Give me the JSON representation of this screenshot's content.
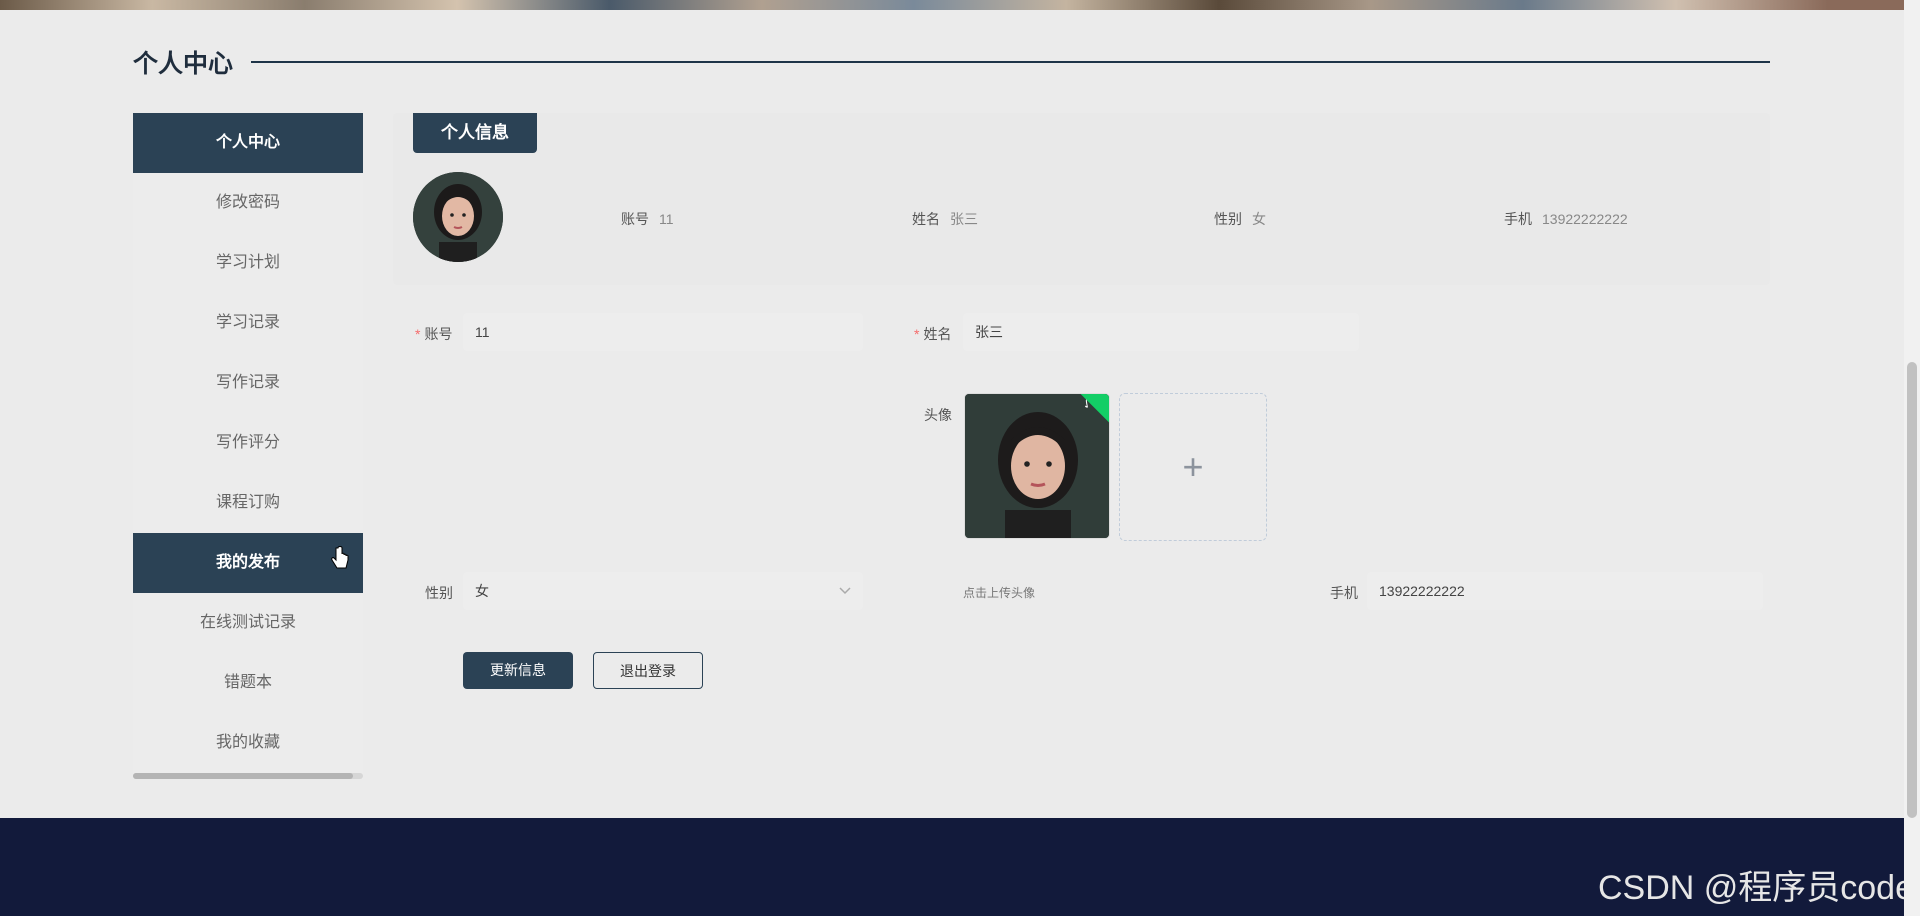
{
  "page": {
    "heading": "个人中心"
  },
  "sidebar": {
    "items": [
      {
        "label": "个人中心",
        "active": true
      },
      {
        "label": "修改密码",
        "active": false
      },
      {
        "label": "学习计划",
        "active": false
      },
      {
        "label": "学习记录",
        "active": false
      },
      {
        "label": "写作记录",
        "active": false
      },
      {
        "label": "写作评分",
        "active": false
      },
      {
        "label": "课程订购",
        "active": false
      },
      {
        "label": "我的发布",
        "active": true
      },
      {
        "label": "在线测试记录",
        "active": false
      },
      {
        "label": "错题本",
        "active": false
      },
      {
        "label": "我的收藏",
        "active": false
      }
    ]
  },
  "info": {
    "tab_label": "个人信息",
    "account_label": "账号",
    "account_value": "11",
    "name_label": "姓名",
    "name_value": "张三",
    "gender_label": "性别",
    "gender_value": "女",
    "phone_label": "手机",
    "phone_value": "13922222222"
  },
  "form": {
    "account_label": "账号",
    "account_value": "11",
    "name_label": "姓名",
    "name_value": "张三",
    "avatar_label": "头像",
    "upload_tip": "点击上传头像",
    "gender_label": "性别",
    "gender_value": "女",
    "phone_label": "手机",
    "phone_value": "13922222222",
    "required_mark": "*"
  },
  "buttons": {
    "update": "更新信息",
    "logout": "退出登录"
  },
  "watermark": "CSDN @程序员code",
  "colors": {
    "primary": "#2b4255",
    "footer": "#121a3b",
    "success": "#13ce66",
    "required": "#f56c6c"
  }
}
